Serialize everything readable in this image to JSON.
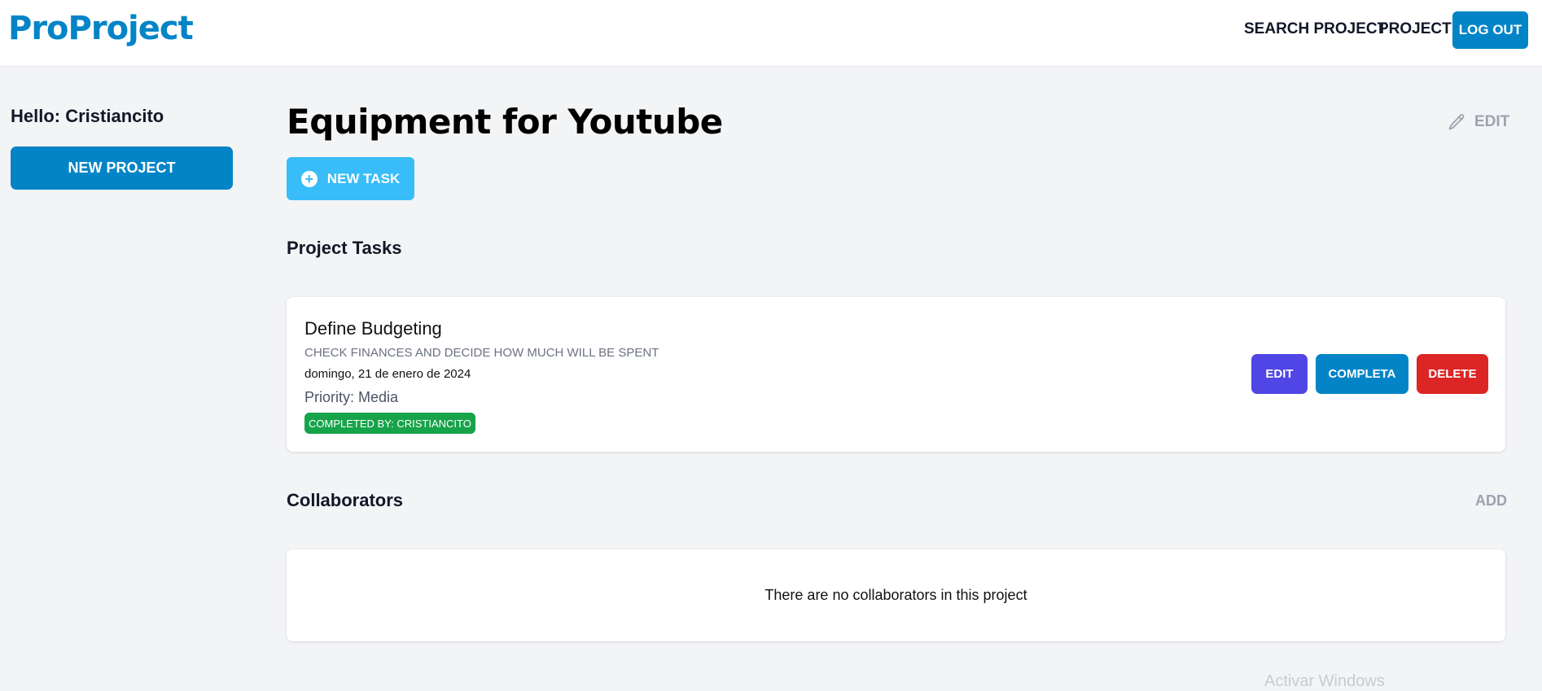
{
  "header": {
    "logo": "ProProject",
    "nav": {
      "search": "SEARCH PROJECT",
      "project": "PROJECT",
      "logout": "LOG OUT"
    }
  },
  "sidebar": {
    "greeting": "Hello: Cristiancito",
    "new_project": "NEW PROJECT"
  },
  "main": {
    "title": "Equipment for Youtube",
    "edit": "EDIT",
    "new_task": "NEW TASK",
    "tasks_heading": "Project Tasks",
    "tasks": [
      {
        "name": "Define Budgeting",
        "description": "CHECK FINANCES AND DECIDE HOW MUCH WILL BE SPENT",
        "date": "domingo, 21 de enero de 2024",
        "priority": "Priority: Media",
        "badge": "COMPLETED BY: CRISTIANCITO",
        "actions": {
          "edit": "EDIT",
          "complete": "COMPLETA",
          "delete": "DELETE"
        }
      }
    ],
    "collaborators_heading": "Collaborators",
    "add": "ADD",
    "collaborators_empty": "There are no collaborators in this project"
  },
  "watermark": "Activar Windows",
  "colors": {
    "primary": "#0284c7",
    "sky": "#38bdf8",
    "indigo": "#4f46e5",
    "red": "#dc2626",
    "green": "#16a34a",
    "background": "#f3f4f6"
  },
  "icons": {
    "edit": "pencil-icon",
    "new_task": "plus-circle-icon"
  }
}
